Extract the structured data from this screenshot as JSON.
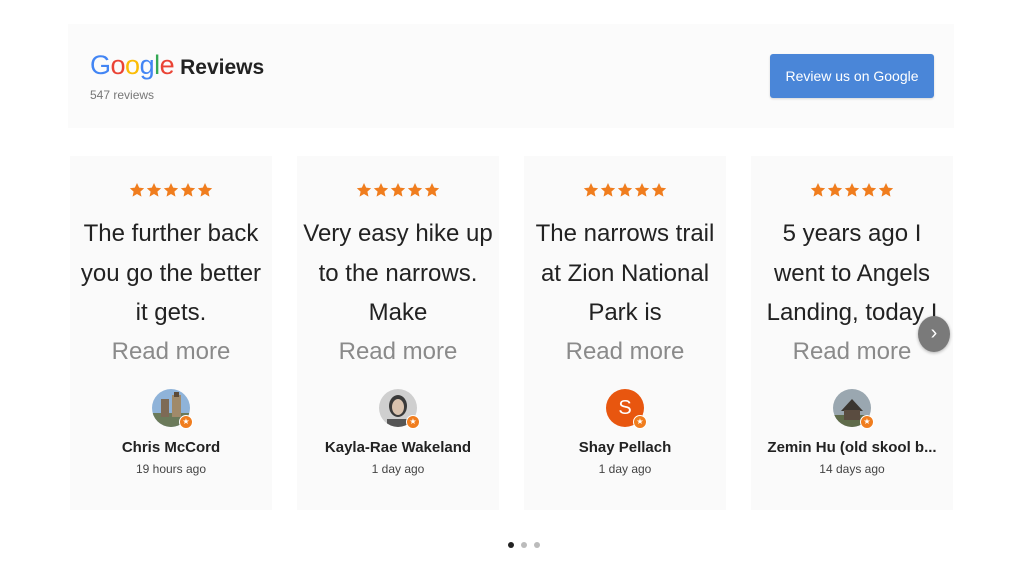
{
  "header": {
    "logo_letters": [
      "G",
      "o",
      "o",
      "g",
      "l",
      "e"
    ],
    "title": "Reviews",
    "review_count": "547 reviews",
    "cta_label": "Review us on Google"
  },
  "reviews": [
    {
      "rating": 5,
      "text": "The further back you go the better it gets.",
      "read_more": "Read more",
      "name": "Chris McCord",
      "time": "19 hours ago",
      "avatar": "photo-avatar-castle"
    },
    {
      "rating": 5,
      "text": "Very easy hike up to the narrows. Make",
      "read_more": "Read more",
      "name": "Kayla-Rae Wakeland",
      "time": "1 day ago",
      "avatar": "photo-avatar-person"
    },
    {
      "rating": 5,
      "text": "The narrows trail at Zion National Park is",
      "read_more": "Read more",
      "name": "Shay Pellach",
      "time": "1 day ago",
      "avatar_letter": "S"
    },
    {
      "rating": 5,
      "text": "5 years ago I went to Angels Landing, today I",
      "read_more": "Read more",
      "name": "Zemin Hu (old skool b...",
      "time": "14 days ago",
      "avatar": "photo-avatar-house"
    }
  ],
  "carousel": {
    "next_icon": "chevron-right-icon",
    "next_glyph": "›",
    "pages": 3,
    "active_page": 1
  },
  "colors": {
    "star": "#f07d1e",
    "button": "#4a86d8",
    "letter_avatar": "#e8560f"
  }
}
